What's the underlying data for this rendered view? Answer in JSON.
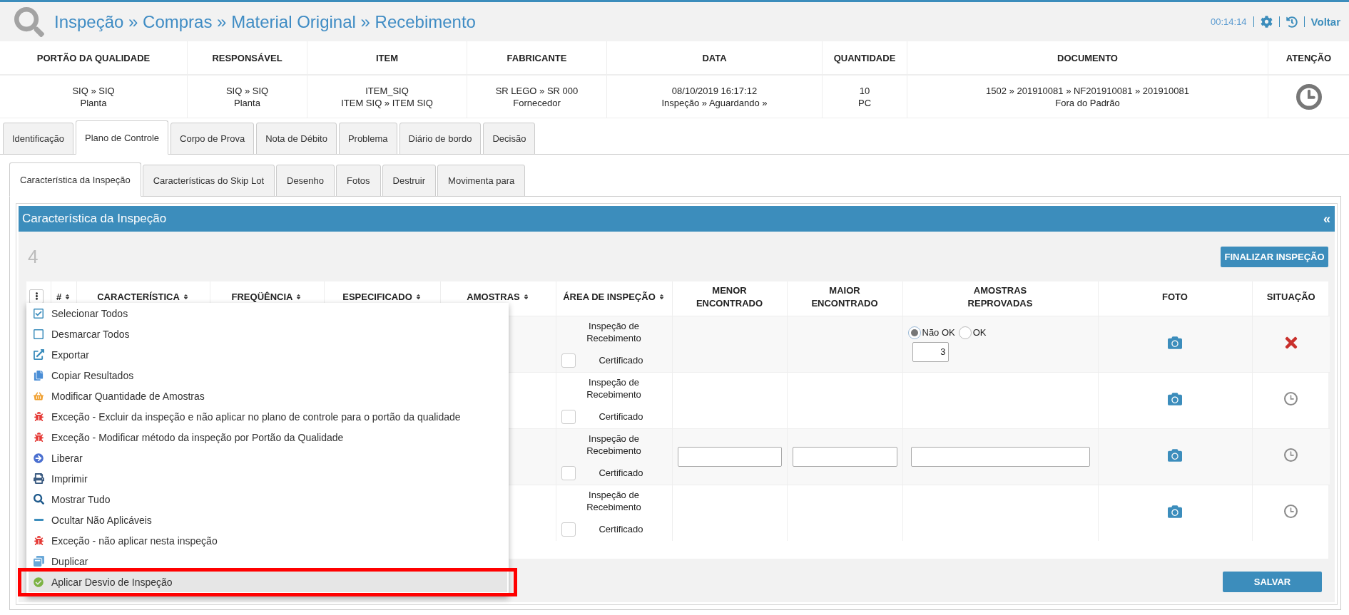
{
  "header": {
    "breadcrumb": "Inspeção » Compras » Material Original » Recebimento",
    "timer": "00:14:14",
    "back_link": "Voltar"
  },
  "summary": [
    {
      "heading": "PORTÃO DA QUALIDADE",
      "kind": "text",
      "lines": [
        "SIQ » SIQ",
        "Planta"
      ]
    },
    {
      "heading": "RESPONSÁVEL",
      "kind": "text",
      "lines": [
        "SIQ » SIQ",
        "Planta"
      ]
    },
    {
      "heading": "ITEM",
      "kind": "text",
      "lines": [
        "ITEM_SIQ",
        "ITEM SIQ » ITEM SIQ"
      ]
    },
    {
      "heading": "FABRICANTE",
      "kind": "text",
      "lines": [
        "SR LEGO » SR 000",
        "Fornecedor"
      ]
    },
    {
      "heading": "DATA",
      "kind": "text",
      "lines": [
        "08/10/2019 16:17:12",
        "Inspeção » Aguardando »"
      ]
    },
    {
      "heading": "QUANTIDADE",
      "kind": "text",
      "lines": [
        "10",
        "PC"
      ]
    },
    {
      "heading": "DOCUMENTO",
      "kind": "text",
      "lines": [
        "1502 » 201910081 » NF201910081 » 201910081",
        "Fora do Padrão"
      ]
    },
    {
      "heading": "ATENÇÃO",
      "kind": "status"
    }
  ],
  "tabs": [
    {
      "label": "Identificação",
      "selected": false
    },
    {
      "label": "Plano de Controle",
      "selected": true
    },
    {
      "label": "Corpo de Prova",
      "selected": false
    },
    {
      "label": "Nota de Débito",
      "selected": false
    },
    {
      "label": "Problema",
      "selected": false
    },
    {
      "label": "Diário de bordo",
      "selected": false
    },
    {
      "label": "Decisão",
      "selected": false
    }
  ],
  "subtabs": [
    {
      "label": "Característica da Inspeção",
      "selected": true
    },
    {
      "label": "Características do Skip Lot",
      "selected": false
    },
    {
      "label": "Desenho",
      "selected": false
    },
    {
      "label": "Fotos",
      "selected": false
    },
    {
      "label": "Destruir",
      "selected": false
    },
    {
      "label": "Movimenta para",
      "selected": false
    }
  ],
  "panel": {
    "title": "Característica da Inspeção",
    "collapse": "«",
    "count": "4",
    "finish_button": "FINALIZAR INSPEÇÃO",
    "save_button": "SALVAR"
  },
  "table": {
    "columns": [
      {
        "label": "#",
        "sortable": true
      },
      {
        "label": "CARACTERÍSTICA",
        "sortable": true
      },
      {
        "label": "FREQÜÊNCIA",
        "sortable": true
      },
      {
        "label": "ESPECIFICADO",
        "sortable": true
      },
      {
        "label": "AMOSTRAS",
        "sortable": true
      },
      {
        "label": "ÁREA DE INSPEÇÃO",
        "sortable": true
      },
      {
        "label": "MENOR\nENCONTRADO",
        "sortable": false
      },
      {
        "label": "MAIOR\nENCONTRADO",
        "sortable": false
      },
      {
        "label": "AMOSTRAS\nREPROVADAS",
        "sortable": false
      },
      {
        "label": "FOTO",
        "sortable": false
      },
      {
        "label": "SITUAÇÃO",
        "sortable": false
      }
    ],
    "rows": [
      {
        "kind": "attribute",
        "area": "Inspeção de\nRecebimento",
        "certificate": "Certificado",
        "certified": false,
        "options": [
          {
            "label": "Não OK",
            "selected": true
          },
          {
            "label": "OK",
            "selected": false
          }
        ],
        "rejected_count": "3",
        "failed": true
      },
      {
        "kind": "plain",
        "area": "Inspeção de\nRecebimento",
        "certificate": "Certificado",
        "certified": false,
        "failed": false
      },
      {
        "kind": "variable",
        "area": "Inspeção de\nRecebimento",
        "certificate": "Certificado",
        "certified": false,
        "failed": false
      },
      {
        "kind": "plain",
        "area": "Inspeção de\nRecebimento",
        "certificate": "Certificado",
        "certified": false,
        "failed": false
      }
    ]
  },
  "menu": {
    "items": [
      {
        "label": "Selecionar Todos",
        "kind": "select",
        "highlighted": false
      },
      {
        "label": "Desmarcar Todos",
        "kind": "deselect",
        "highlighted": false
      },
      {
        "label": "Exportar",
        "kind": "export",
        "highlighted": false
      },
      {
        "label": "Copiar Resultados",
        "kind": "copy",
        "highlighted": false
      },
      {
        "label": "Modificar Quantidade de Amostras",
        "kind": "quantity",
        "highlighted": false
      },
      {
        "label": "Exceção - Excluir da inspeção e não aplicar no plano de controle para o portão da qualidade",
        "kind": "exception",
        "highlighted": false
      },
      {
        "label": "Exceção - Modificar método da inspeção por Portão da Qualidade",
        "kind": "exception",
        "highlighted": false
      },
      {
        "label": "Liberar",
        "kind": "release",
        "highlighted": false
      },
      {
        "label": "Imprimir",
        "kind": "print",
        "highlighted": false
      },
      {
        "label": "Mostrar Tudo",
        "kind": "show",
        "highlighted": false
      },
      {
        "label": "Ocultar Não Aplicáveis",
        "kind": "hide",
        "highlighted": false
      },
      {
        "label": "Exceção - não aplicar nesta inspeção",
        "kind": "exception",
        "highlighted": false
      },
      {
        "label": "Duplicar",
        "kind": "duplicate",
        "highlighted": false
      },
      {
        "label": "Aplicar Desvio de Inspeção",
        "kind": "deviation",
        "highlighted": true
      }
    ]
  }
}
